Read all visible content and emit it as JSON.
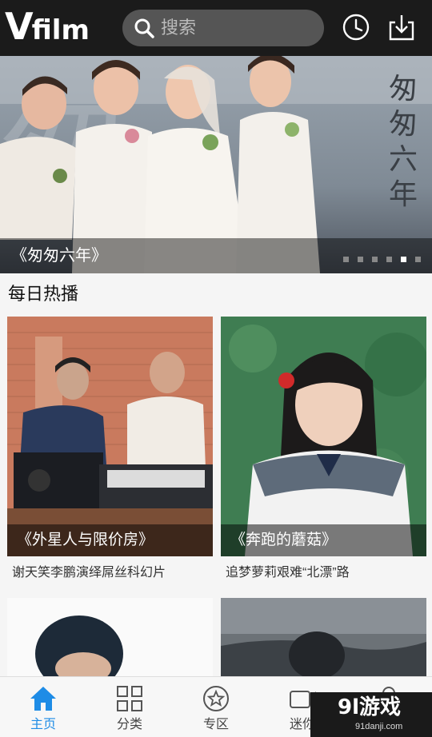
{
  "header": {
    "logo_v": "V",
    "logo_rest": "film",
    "search_placeholder": "搜索",
    "history_icon": "clock-icon",
    "download_icon": "download-icon"
  },
  "banner": {
    "vertical_title": "匆匆六年",
    "caption": "《匆匆六年》",
    "dots_total": 6,
    "active_dot_index": 4
  },
  "section": {
    "title": "每日热播"
  },
  "cards": [
    {
      "caption": "《外星人与限价房》",
      "desc": "谢天笑李鹏演绎屌丝科幻片"
    },
    {
      "caption": "《奔跑的蘑菇》",
      "desc": "追梦萝莉艰难“北漂”路"
    }
  ],
  "tabs": [
    {
      "label": "主页",
      "icon": "home-icon",
      "active": true
    },
    {
      "label": "分类",
      "icon": "grid-icon",
      "active": false
    },
    {
      "label": "专区",
      "icon": "star-icon",
      "active": false
    },
    {
      "label": "迷你",
      "icon": "video-icon",
      "active": false
    },
    {
      "label": "",
      "icon": "user-icon",
      "active": false
    }
  ],
  "watermark": {
    "text": "9l游戏",
    "url": "91danji.com"
  },
  "colors": {
    "header_bg": "#1b1b1b",
    "accent": "#1e8ce6"
  }
}
